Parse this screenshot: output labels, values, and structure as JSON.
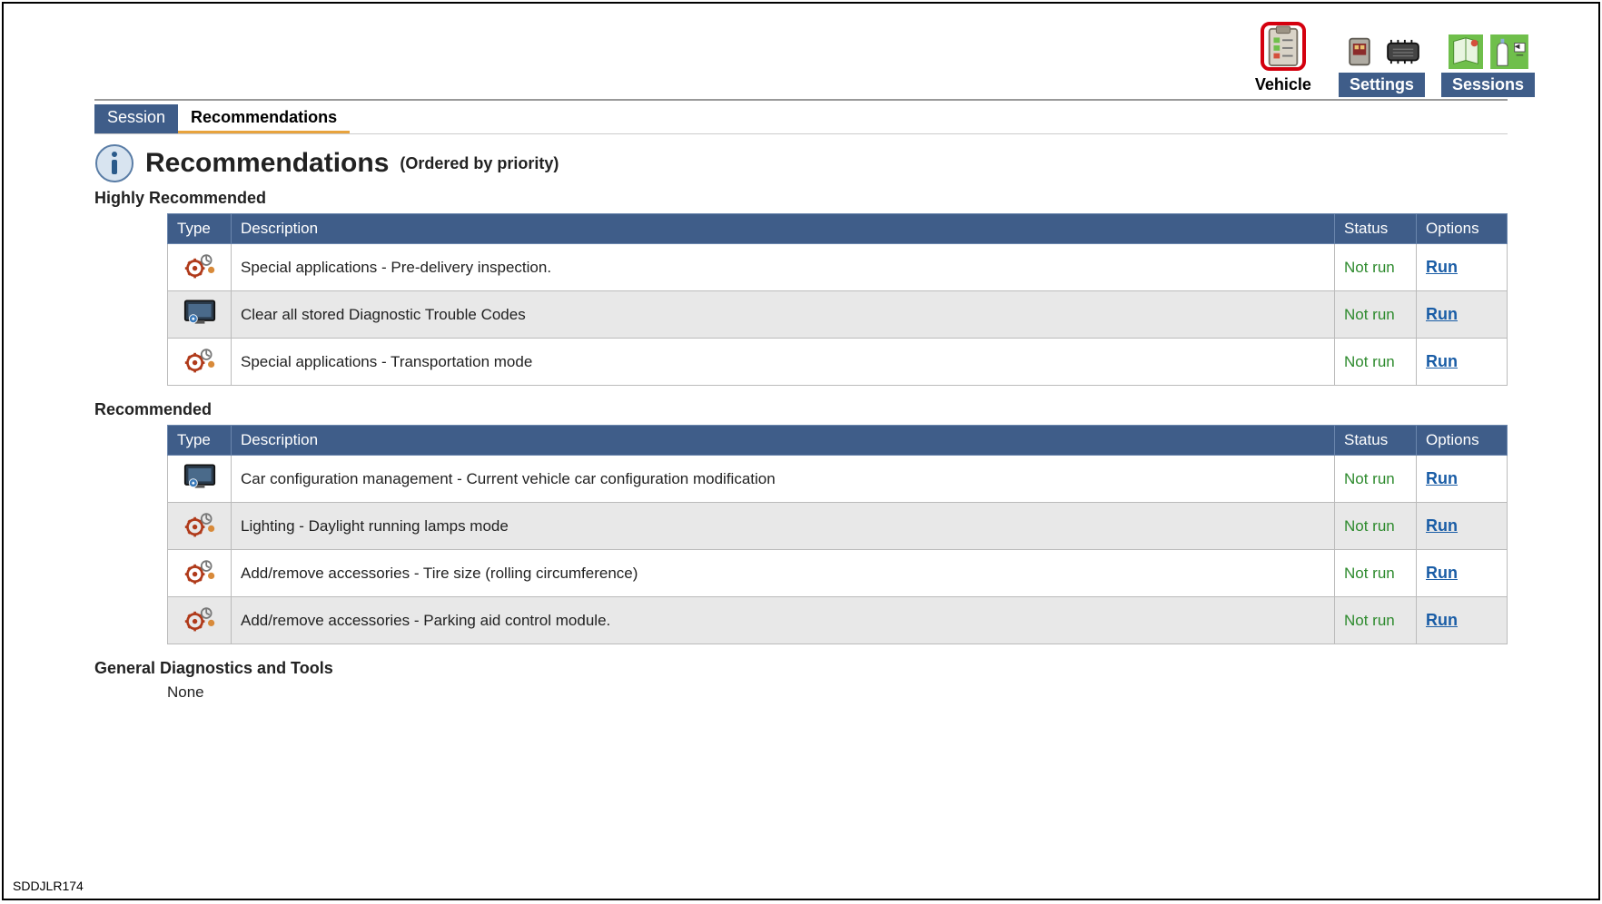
{
  "toolbar": {
    "tabs": [
      {
        "label": "Vehicle",
        "active": true
      },
      {
        "label": "Settings",
        "active": false
      },
      {
        "label": "Sessions",
        "active": false
      }
    ]
  },
  "subtabs": {
    "session": "Session",
    "recommendations": "Recommendations"
  },
  "heading": {
    "title": "Recommendations",
    "subtitle": "(Ordered by priority)"
  },
  "sections": {
    "highly": {
      "label": "Highly Recommended",
      "cols": {
        "type": "Type",
        "desc": "Description",
        "status": "Status",
        "options": "Options"
      },
      "rows": [
        {
          "icon": "gears",
          "desc": "Special applications - Pre-delivery inspection.",
          "status": "Not run",
          "action": "Run"
        },
        {
          "icon": "monitor",
          "desc": "Clear all stored Diagnostic Trouble Codes",
          "status": "Not run",
          "action": "Run"
        },
        {
          "icon": "gears",
          "desc": "Special applications - Transportation mode",
          "status": "Not run",
          "action": "Run"
        }
      ]
    },
    "recommended": {
      "label": "Recommended",
      "cols": {
        "type": "Type",
        "desc": "Description",
        "status": "Status",
        "options": "Options"
      },
      "rows": [
        {
          "icon": "monitor",
          "desc": "Car configuration management - Current vehicle car configuration modification",
          "status": "Not run",
          "action": "Run"
        },
        {
          "icon": "gears",
          "desc": "Lighting - Daylight running lamps mode",
          "status": "Not run",
          "action": "Run"
        },
        {
          "icon": "gears",
          "desc": "Add/remove accessories - Tire size (rolling circumference)",
          "status": "Not run",
          "action": "Run"
        },
        {
          "icon": "gears",
          "desc": "Add/remove accessories - Parking aid control module.",
          "status": "Not run",
          "action": "Run"
        }
      ]
    },
    "general": {
      "label": "General Diagnostics and Tools",
      "none": "None"
    }
  },
  "footer_code": "SDDJLR174"
}
